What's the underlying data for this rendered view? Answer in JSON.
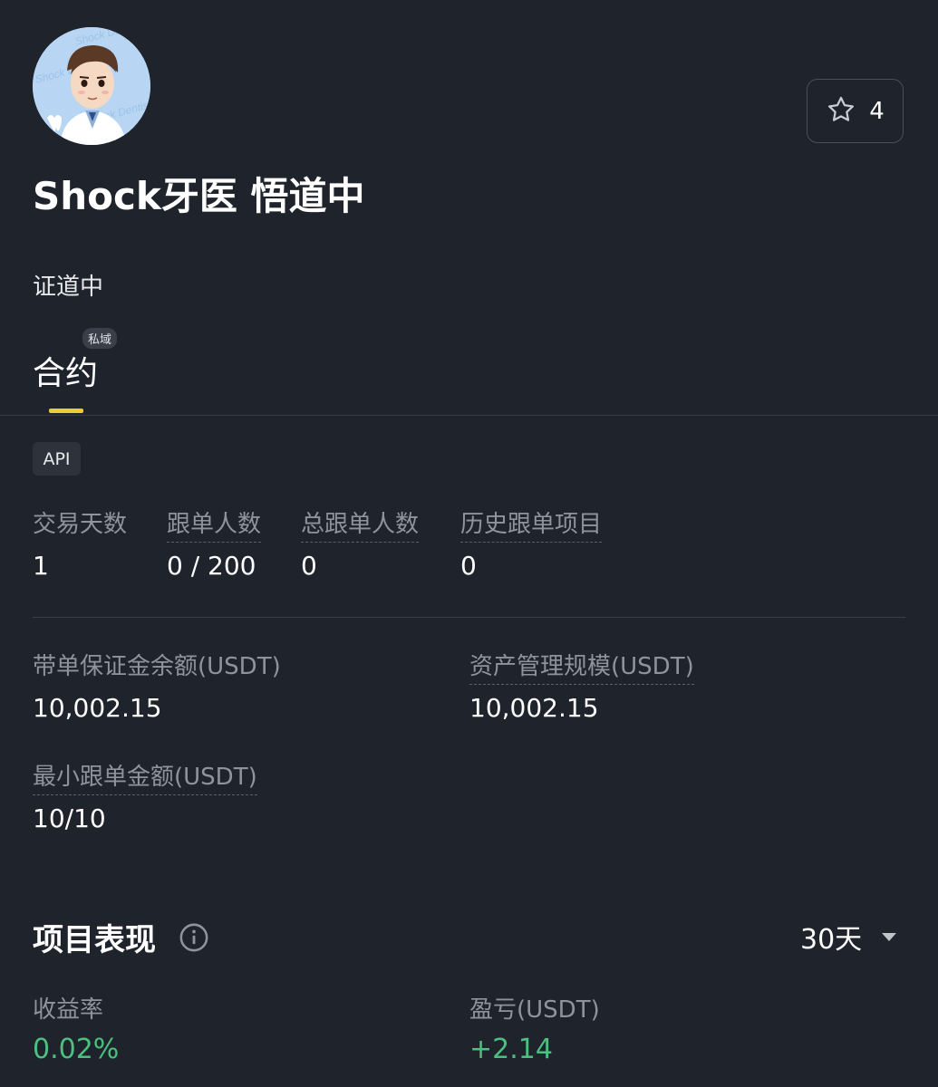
{
  "profile": {
    "name": "Shock牙医 悟道中",
    "bio": "证道中",
    "favorite_count": "4"
  },
  "tabs": [
    {
      "label": "合约",
      "badge": "私域",
      "active": true
    }
  ],
  "tag": "API",
  "stats_row": [
    {
      "label": "交易天数",
      "value": "1"
    },
    {
      "label": "跟单人数",
      "value": "0 / 200"
    },
    {
      "label": "总跟单人数",
      "value": "0"
    },
    {
      "label": "历史跟单项目",
      "value": "0"
    }
  ],
  "funds": {
    "margin_balance": {
      "label": "带单保证金余额(USDT)",
      "value": "10,002.15"
    },
    "aum": {
      "label": "资产管理规模(USDT)",
      "value": "10,002.15"
    },
    "min_copy": {
      "label": "最小跟单金额(USDT)",
      "value": "10/10"
    }
  },
  "performance": {
    "title": "项目表现",
    "period": "30天",
    "roi": {
      "label": "收益率",
      "value": "0.02%"
    },
    "pnl": {
      "label": "盈亏(USDT)",
      "value": "+2.14"
    }
  },
  "colors": {
    "background": "#1f232c",
    "accent": "#f0c93b",
    "positive": "#4cc07f"
  },
  "icons": [
    "avatar",
    "star-icon",
    "info-icon",
    "caret-down-icon"
  ]
}
